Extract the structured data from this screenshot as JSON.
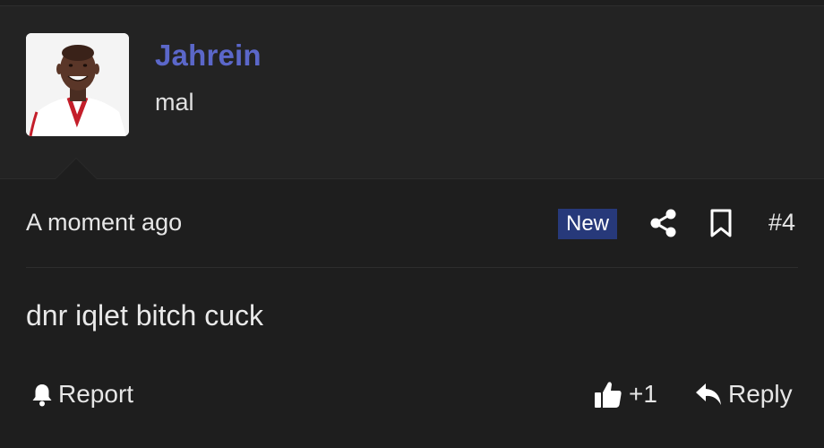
{
  "post": {
    "username": "Jahrein",
    "user_title": "mal",
    "timestamp": "A moment ago",
    "badge": "New",
    "post_number": "#4",
    "content": "dnr iqlet bitch cuck"
  },
  "actions": {
    "report_label": "Report",
    "like_count": "+1",
    "reply_label": "Reply"
  },
  "icons": {
    "share": "share-icon",
    "bookmark": "bookmark-icon",
    "report": "bell-icon",
    "like": "thumbs-up-icon",
    "reply": "reply-arrow-icon"
  },
  "colors": {
    "background": "#1e1e1e",
    "username": "#5b67c9",
    "badge_bg": "#27397a"
  }
}
